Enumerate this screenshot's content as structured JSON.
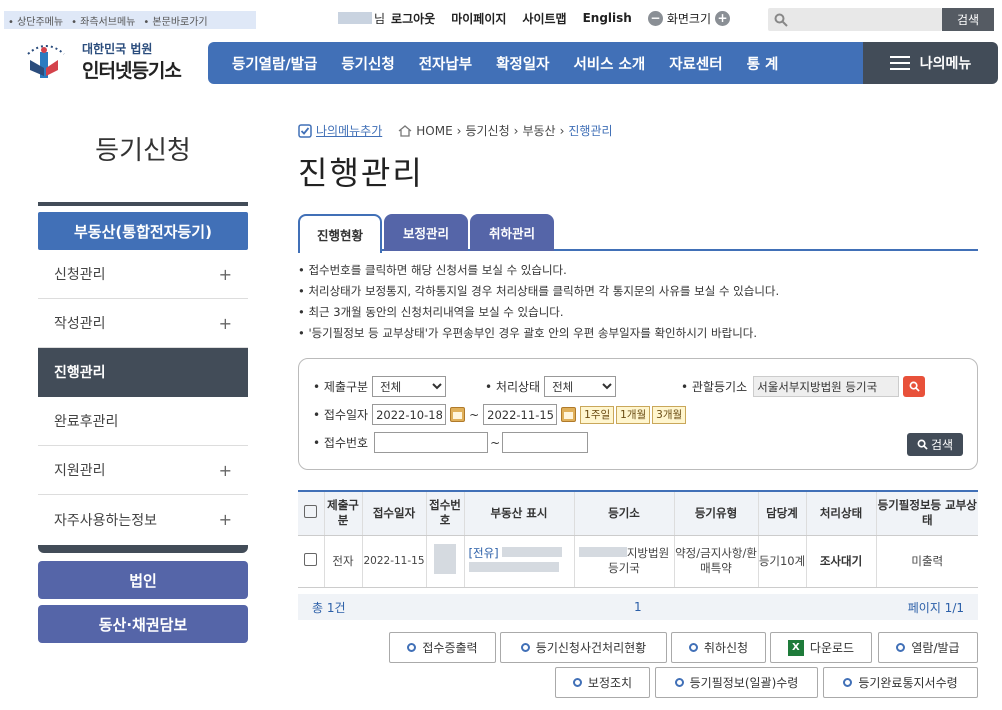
{
  "skip_links": [
    "• 상단주메뉴",
    "• 좌측서브메뉴",
    "• 본문바로가기"
  ],
  "util": {
    "name_suffix": "님",
    "logout": "로그아웃",
    "mypage": "마이페이지",
    "sitemap": "사이트맵",
    "english": "English",
    "screen_size": "화면크기",
    "search_button": "검색"
  },
  "logo": {
    "line1": "대한민국 법원",
    "line2": "인터넷등기소"
  },
  "gnb": [
    "등기열람/발급",
    "등기신청",
    "전자납부",
    "확정일자",
    "서비스 소개",
    "자료센터",
    "통 계"
  ],
  "my_menu": "나의메뉴",
  "sidebar": {
    "title": "등기신청",
    "category": "부동산(통합전자등기)",
    "items": [
      {
        "label": "신청관리",
        "plus": "+"
      },
      {
        "label": "작성관리",
        "plus": "+"
      },
      {
        "label": "진행관리",
        "plus": ""
      },
      {
        "label": "완료후관리",
        "plus": ""
      },
      {
        "label": "지원관리",
        "plus": "+"
      },
      {
        "label": "자주사용하는정보",
        "plus": "+"
      }
    ],
    "btn_corp": "법인",
    "btn_movable": "동산·채권담보"
  },
  "breadcrumb": {
    "add_menu": "나의메뉴추가",
    "home": "HOME",
    "path1": "등기신청",
    "path2": "부동산",
    "current": "진행관리"
  },
  "page_title": "진행관리",
  "tabs": [
    "진행현황",
    "보정관리",
    "취하관리"
  ],
  "notes": [
    "• 접수번호를 클릭하면 해당 신청서를 보실 수 있습니다.",
    "• 처리상태가 보정통지, 각하통지일 경우 처리상태를 클릭하면 각 통지문의 사유를 보실 수 있습니다.",
    "• 최근 3개월 동안의 신청처리내역을 보실 수 있습니다.",
    "• '등기필정보 등 교부상태'가 우편송부인 경우 괄호 안의 우편 송부일자를 확인하시기 바랍니다."
  ],
  "search": {
    "submit_type_label": "제출구분",
    "submit_type_value": "전체",
    "status_label": "처리상태",
    "status_value": "전체",
    "office_label": "관할등기소",
    "office_value": "서울서부지방법원 등기국",
    "date_label": "접수일자",
    "date_from": "2022-10-18",
    "date_sep": "~",
    "date_to": "2022-11-15",
    "period_week": "1주일",
    "period_month": "1개월",
    "period_3month": "3개월",
    "receipt_label": "접수번호",
    "receipt_sep": "~",
    "search_button": "검색"
  },
  "table": {
    "headers": [
      "제출구분",
      "접수일자",
      "접수번호",
      "부동산 표시",
      "등기소",
      "등기유형",
      "담당계",
      "처리상태",
      "등기필정보등 교부상태"
    ],
    "row": {
      "submit_type": "전자",
      "date": "2022-11-15",
      "property_prefix": "[전유]",
      "office": "지방법원 등기국",
      "type": "약정/금지사항/환매특약",
      "team": "등기10계",
      "status": "조사대기",
      "issue_status": "미출력"
    }
  },
  "footer": {
    "total": "총 1건",
    "page": "1",
    "page_info": "페이지 1/1"
  },
  "buttons": {
    "receipt_print": "접수증출력",
    "case_status": "등기신청사건처리현황",
    "withdraw": "취하신청",
    "download": "다운로드",
    "view_issue": "열람/발급",
    "correction": "보정조치",
    "cert_receive": "등기필정보(일괄)수령",
    "complete_notice": "등기완료통지서수령"
  }
}
